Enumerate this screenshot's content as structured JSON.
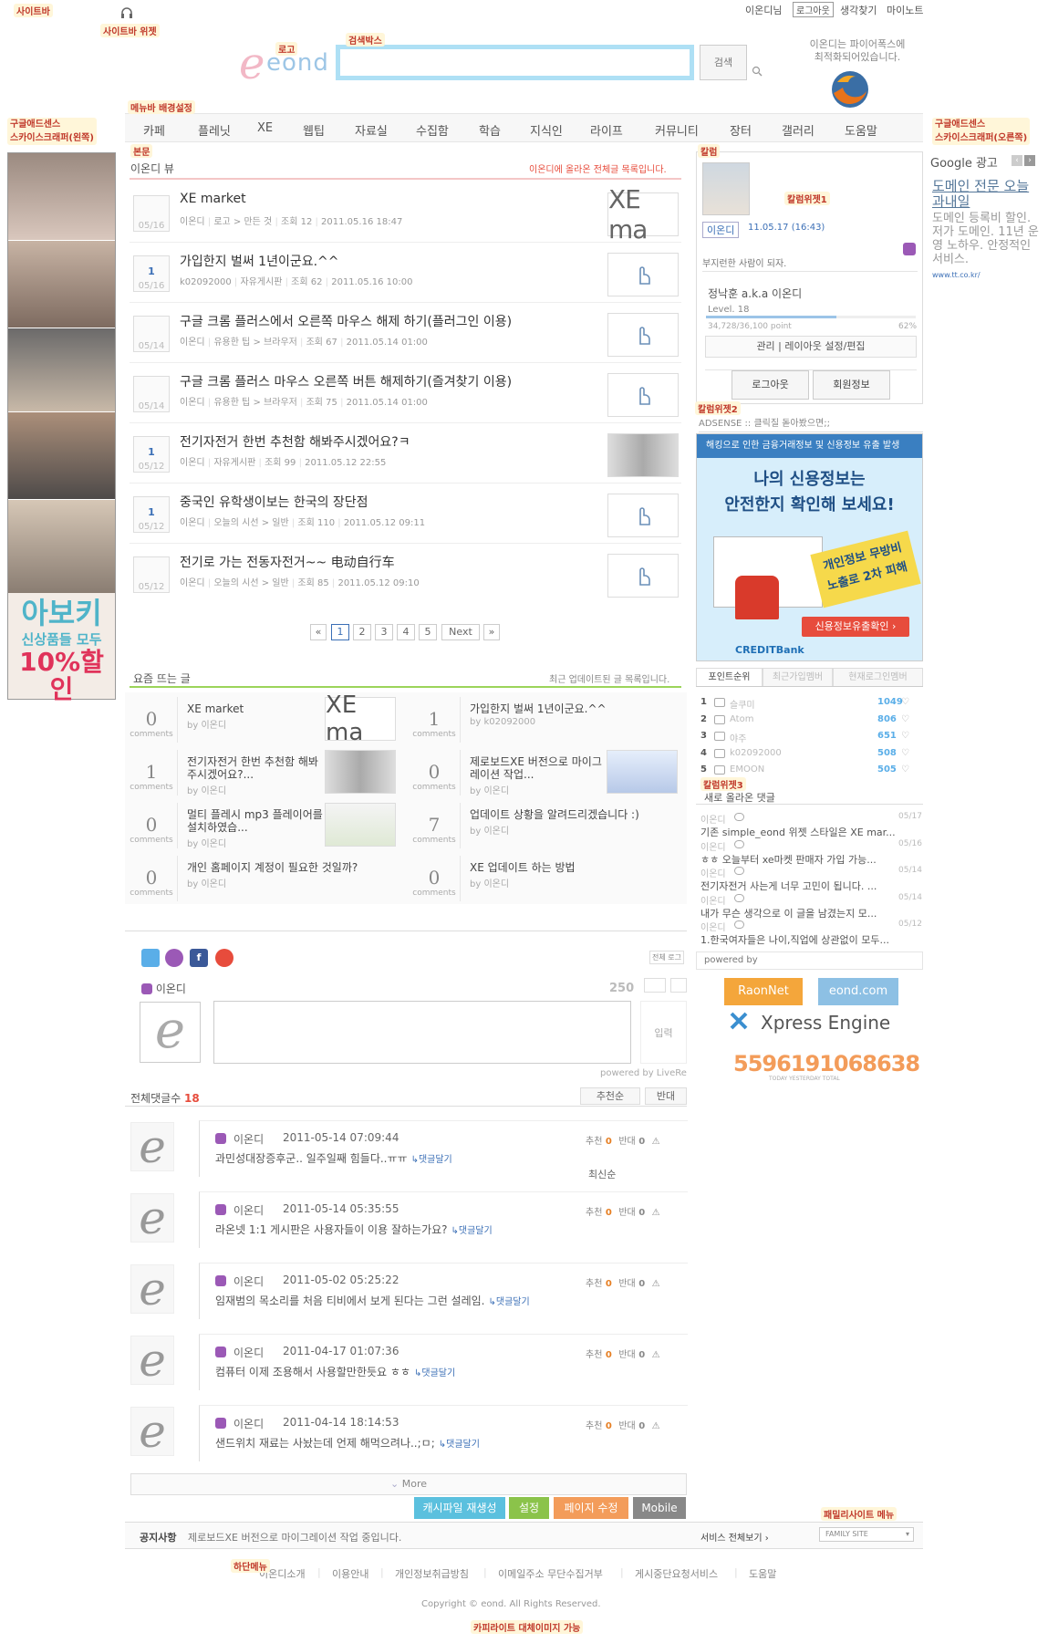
{
  "notes": {
    "sitebar": "사이트바",
    "sitebar_widget": "사이트바 위젯",
    "logo": "로고",
    "searchbox": "검색박스",
    "menubar": "메뉴바 배경설정",
    "adsense_left": "구글애드센스\n스카이스크래퍼(왼쪽)",
    "adsense_right": "구글애드센스\n스카이스크래퍼(오른쪽)",
    "body": "본문",
    "column": "칼럼",
    "column_widget1": "칼럼위젯1",
    "column_widget2": "칼럼위젯2",
    "column_widget3": "칼럼위젯3",
    "family_menu": "패밀리사이트 메뉴",
    "bottom_menu": "하단메뉴",
    "copyright_alt": "카피라이트 대체이미지 가능"
  },
  "topbar": {
    "user": "이온디님",
    "logout": "로그아웃",
    "remember": "생각찾기",
    "mynote": "마이노트"
  },
  "logo_text": "eond",
  "search": {
    "button": "검색",
    "placeholder": ""
  },
  "firefox_msg": "이온디는 파이어폭스에\n최적화되어있습니다.",
  "nav": [
    "카페",
    "플레닛",
    "XE",
    "웹팁",
    "자료실",
    "수집함",
    "학습",
    "지식인",
    "라이프",
    "커뮤니티",
    "장터",
    "갤러리",
    "도움말"
  ],
  "left_ad": {
    "line1": "아보키",
    "line2": "신상품들 모두",
    "line3": "10%할인"
  },
  "view": {
    "title": "이온디 뷰",
    "subtitle": "이온디에 올라온 전체글 목록입니다.",
    "items": [
      {
        "title": "XE market",
        "author": "이온디",
        "cat": "로고 > 만든 것",
        "views": "조회 12",
        "date": "2011.05.16 18:47",
        "cnt": "",
        "d": "05/16"
      },
      {
        "title": "가입한지 벌써 1년이군요.^^",
        "author": "k02092000",
        "cat": "자유게시판",
        "views": "조회 62",
        "date": "2011.05.16 10:00",
        "cnt": "1",
        "d": "05/16"
      },
      {
        "title": "구글 크롬 플러스에서 오른쪽 마우스 해제 하기(플러그인 이용)",
        "author": "이온디",
        "cat": "유용한 팁 > 브라우저",
        "views": "조회 67",
        "date": "2011.05.14 01:00",
        "cnt": "",
        "d": "05/14"
      },
      {
        "title": "구글 크롬 플러스 마우스 오른쪽 버튼 해제하기(즐겨찾기 이용)",
        "author": "이온디",
        "cat": "유용한 팁 > 브라우저",
        "views": "조회 75",
        "date": "2011.05.14 01:00",
        "cnt": "",
        "d": "05/14"
      },
      {
        "title": "전기자전거 한번 추천함 해봐주시겠어요?ㅋ",
        "author": "이온디",
        "cat": "자유게시판",
        "views": "조회 99",
        "date": "2011.05.12 22:55",
        "cnt": "1",
        "d": "05/12"
      },
      {
        "title": "중국인 유학생이보는 한국의 장단점",
        "author": "이온디",
        "cat": "오늘의 시선 > 일반",
        "views": "조회 110",
        "date": "2011.05.12 09:11",
        "cnt": "1",
        "d": "05/12"
      },
      {
        "title": "전기로 가는 전동자전거~~ 电动自行车",
        "author": "이온디",
        "cat": "오늘의 시선 > 일반",
        "views": "조회 85",
        "date": "2011.05.12 09:10",
        "cnt": "",
        "d": "05/12"
      }
    ]
  },
  "pagination": {
    "prev": "«",
    "pages": [
      "1",
      "2",
      "3",
      "4",
      "5"
    ],
    "next": "Next",
    "last": "»"
  },
  "hot": {
    "title": "요즘 뜨는 글",
    "subtitle": "최근 업데이트된 글 목록입니다.",
    "label": "comments",
    "items": [
      {
        "n": "0",
        "title": "XE market",
        "by": "by 이온디"
      },
      {
        "n": "1",
        "title": "가입한지 벌써 1년이군요.^^",
        "by": "by k02092000"
      },
      {
        "n": "1",
        "title": "전기자전거 한번 추천함 해봐\n주시겠어요?...",
        "by": "by 이온디"
      },
      {
        "n": "0",
        "title": "제로보드XE 버전으로 마이그\n레이션 작업...",
        "by": "by 이온디"
      },
      {
        "n": "0",
        "title": "멀티 플레시 mp3 플레이어를\n설치하였습...",
        "by": "by 이온디"
      },
      {
        "n": "7",
        "title": "업데이트 상황을 알려드리겠습니다 :)",
        "by": "by 이온디"
      },
      {
        "n": "0",
        "title": "개인 홈페이지 계정이 필요한 것일까?",
        "by": "by 이온디"
      },
      {
        "n": "0",
        "title": "XE 업데이트 하는 방법",
        "by": "by 이온디"
      }
    ]
  },
  "livere": {
    "user": "이온디",
    "count": "250",
    "submit": "입력",
    "powered": "powered by LiveRe",
    "login_tag": "전체 로그"
  },
  "comments": {
    "total_label": "전체댓글수",
    "total": "18",
    "sort1": "추천순",
    "sort2": "반대",
    "sort_latest": "최신순",
    "vote_label": "추천",
    "oppose_label": "반대",
    "reply_label": "↳댓글달기",
    "list": [
      {
        "name": "이온디",
        "date": "2011-05-14 07:09:44",
        "text": "과민성대장증후군.. 일주일째 힘들다..ㅠㅠ"
      },
      {
        "name": "이온디",
        "date": "2011-05-14 05:35:55",
        "text": "라온넷 1:1 게시판은 사용자들이 이용 잘하는가요?"
      },
      {
        "name": "이온디",
        "date": "2011-05-02 05:25:22",
        "text": "임재범의 목소리를 처음 티비에서 보게 된다는 그런 설레임."
      },
      {
        "name": "이온디",
        "date": "2011-04-17 01:07:36",
        "text": "컴퓨터 이제 조용해서 사용할만한듯요 ㅎㅎ"
      },
      {
        "name": "이온디",
        "date": "2011-04-14 18:14:53",
        "text": "샌드위치 재료는 사놨는데 언제 해먹으려나..;ㅁ;"
      }
    ],
    "more": "More"
  },
  "actions": {
    "cache": "캐시파일 재생성",
    "settings": "설정",
    "edit": "페이지 수정",
    "mobile": "Mobile"
  },
  "notice": {
    "label": "공지사항",
    "text": "제로보드XE 버전으로 마이그레이션 작업 중입니다.",
    "service": "서비스 전체보기 ›",
    "family": "FAMILY SITE"
  },
  "footer": {
    "links": [
      "이온디소개",
      "이용안내",
      "개인정보취급방침",
      "이메일주소 무단수집거부",
      "게시중단요청서비스",
      "도움말"
    ],
    "copyright": "Copyright © eond. All Rights Reserved."
  },
  "profile": {
    "name": "이온디",
    "time": "11.05.17 (16:43)",
    "motto": "부지런한 사람이 되자.",
    "nick": "정낙훈 a.k.a 이온디",
    "level": "Level. 18",
    "points": "34,728/36,100 point",
    "percent": "62%",
    "manage": "관리",
    "layout": "레이아웃 설정/편집",
    "logout": "로그아웃",
    "member": "회원정보"
  },
  "adsense_label": "ADSENSE :: 클릭질 돋아봤으면;;",
  "credit_ad": {
    "top": "해킹으로 인한 금융거래정보 및 신용정보 유출 발생",
    "headline": "나의 신용정보는\n안전한지 확인해 보세요!",
    "badge": "개인정보 무방비\n노출로 2차 피해",
    "cta": "신용정보유출확인 ›",
    "brand": "CREDITBank"
  },
  "rank": {
    "tabs": [
      "포인트순위",
      "최근가입멤버",
      "현재로그인멤버"
    ],
    "rows": [
      {
        "r": "1",
        "name": "슬쿠미",
        "pts": "1049"
      },
      {
        "r": "2",
        "name": "Atom",
        "pts": "806"
      },
      {
        "r": "3",
        "name": "야주",
        "pts": "651"
      },
      {
        "r": "4",
        "name": "k02092000",
        "pts": "508"
      },
      {
        "r": "5",
        "name": "EMOON",
        "pts": "505"
      }
    ]
  },
  "recent": {
    "title": "새로 올라온 댓글",
    "items": [
      {
        "name": "이온디",
        "d": "05/17",
        "text": "기존 simple_eond 위젯 스타일은 XE mar..."
      },
      {
        "name": "이온디",
        "d": "05/16",
        "text": "ㅎㅎ 오늘부터 xe마켓 판매자 가입 가능..."
      },
      {
        "name": "이온디",
        "d": "05/14",
        "text": "전기자전거 사는게 너무 고민이 됩니다. ..."
      },
      {
        "name": "이온디",
        "d": "05/14",
        "text": "내가 무슨 생각으로 이 글을 남겼는지 모..."
      },
      {
        "name": "이온디",
        "d": "05/12",
        "text": "1.한국여자들은 나이,직업에 상관없이 모두..."
      }
    ]
  },
  "powered_by": "powered by",
  "partners": {
    "raon": "RaonNet",
    "eond": "eond.com",
    "xe": "Xpress Engine"
  },
  "counter": {
    "value": "5596191068638",
    "label": "TODAY YESTERDAY TOTAL"
  },
  "google_ad": {
    "brand": "Google 광고",
    "title": "도메인 전문 오늘과내일",
    "body": "도메인 등록비 할인. 저가 도메인. 11년 운영 노하우. 안정적인 서비스.",
    "url": "www.tt.co.kr/"
  },
  "colors": {
    "accent": "#e74c3c",
    "link": "#3b6fb6",
    "search_border": "#aee0f5",
    "hot_line": "#9bd45a"
  }
}
